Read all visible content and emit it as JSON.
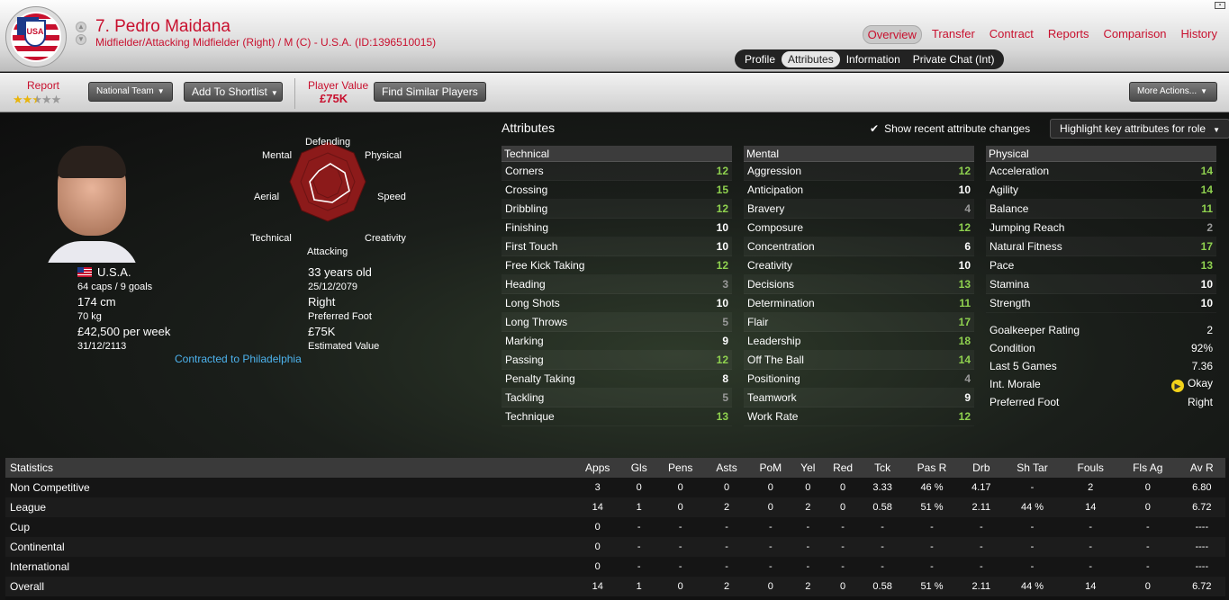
{
  "header": {
    "player_name": "7. Pedro Maidana",
    "subtitle": "Midfielder/Attacking Midfielder (Right) / M (C) - U.S.A. (ID:1396510015)",
    "crest_text": "USA",
    "nav": [
      "Overview",
      "Transfer",
      "Contract",
      "Reports",
      "Comparison",
      "History"
    ],
    "nav_active": "Overview",
    "subtabs": [
      "Profile",
      "Attributes",
      "Information",
      "Private Chat (Int)"
    ],
    "subtab_active": "Attributes"
  },
  "toolbar": {
    "report_label": "Report",
    "report_stars": 2.5,
    "national_team": "National Team",
    "add_shortlist": "Add To Shortlist",
    "player_value_label": "Player Value",
    "player_value": "£75K",
    "find_similar": "Find Similar Players",
    "more_actions": "More Actions..."
  },
  "profile": {
    "radar_labels": {
      "defending": "Defending",
      "physical": "Physical",
      "speed": "Speed",
      "creativity": "Creativity",
      "attacking": "Attacking",
      "technical": "Technical",
      "aerial": "Aerial",
      "mental": "Mental"
    },
    "nationality": "U.S.A.",
    "caps_goals": "64 caps / 9 goals",
    "height": "174 cm",
    "weight": "70 kg",
    "wage": "£42,500 per week",
    "contract_end": "31/12/2113",
    "age": "33 years old",
    "dob": "25/12/2079",
    "preferred_foot": "Right",
    "preferred_foot_label": "Preferred Foot",
    "estimated_value": "£75K",
    "estimated_value_label": "Estimated Value",
    "contracted_to": "Contracted to Philadelphia"
  },
  "attributes": {
    "title": "Attributes",
    "show_changes_label": "Show recent attribute changes",
    "show_changes_checked": true,
    "highlight_button": "Highlight key attributes for role",
    "technical": {
      "heading": "Technical",
      "items": [
        {
          "name": "Corners",
          "value": "12"
        },
        {
          "name": "Crossing",
          "value": "15"
        },
        {
          "name": "Dribbling",
          "value": "12"
        },
        {
          "name": "Finishing",
          "value": "10"
        },
        {
          "name": "First Touch",
          "value": "10"
        },
        {
          "name": "Free Kick Taking",
          "value": "12"
        },
        {
          "name": "Heading",
          "value": "3"
        },
        {
          "name": "Long Shots",
          "value": "10"
        },
        {
          "name": "Long Throws",
          "value": "5"
        },
        {
          "name": "Marking",
          "value": "9"
        },
        {
          "name": "Passing",
          "value": "12"
        },
        {
          "name": "Penalty Taking",
          "value": "8"
        },
        {
          "name": "Tackling",
          "value": "5"
        },
        {
          "name": "Technique",
          "value": "13"
        }
      ]
    },
    "mental": {
      "heading": "Mental",
      "items": [
        {
          "name": "Aggression",
          "value": "12"
        },
        {
          "name": "Anticipation",
          "value": "10"
        },
        {
          "name": "Bravery",
          "value": "4"
        },
        {
          "name": "Composure",
          "value": "12"
        },
        {
          "name": "Concentration",
          "value": "6"
        },
        {
          "name": "Creativity",
          "value": "10"
        },
        {
          "name": "Decisions",
          "value": "13"
        },
        {
          "name": "Determination",
          "value": "11"
        },
        {
          "name": "Flair",
          "value": "17"
        },
        {
          "name": "Leadership",
          "value": "18"
        },
        {
          "name": "Off The Ball",
          "value": "14"
        },
        {
          "name": "Positioning",
          "value": "4"
        },
        {
          "name": "Teamwork",
          "value": "9"
        },
        {
          "name": "Work Rate",
          "value": "12"
        }
      ]
    },
    "physical": {
      "heading": "Physical",
      "items": [
        {
          "name": "Acceleration",
          "value": "14"
        },
        {
          "name": "Agility",
          "value": "14"
        },
        {
          "name": "Balance",
          "value": "11"
        },
        {
          "name": "Jumping Reach",
          "value": "2"
        },
        {
          "name": "Natural Fitness",
          "value": "17"
        },
        {
          "name": "Pace",
          "value": "13"
        },
        {
          "name": "Stamina",
          "value": "10"
        },
        {
          "name": "Strength",
          "value": "10"
        }
      ]
    },
    "extra": [
      {
        "name": "Goalkeeper Rating",
        "value": "2"
      },
      {
        "name": "Condition",
        "value": "92%"
      },
      {
        "name": "Last 5 Games",
        "value": "7.36"
      },
      {
        "name": "Int. Morale",
        "value": "Okay"
      },
      {
        "name": "Preferred Foot",
        "value": "Right"
      }
    ]
  },
  "statistics": {
    "headers": [
      "Statistics",
      "Apps",
      "Gls",
      "Pens",
      "Asts",
      "PoM",
      "Yel",
      "Red",
      "Tck",
      "Pas R",
      "Drb",
      "Sh Tar",
      "Fouls",
      "Fls Ag",
      "Av R"
    ],
    "rows": [
      [
        "Non Competitive",
        "3",
        "0",
        "0",
        "0",
        "0",
        "0",
        "0",
        "3.33",
        "46 %",
        "4.17",
        "-",
        "2",
        "0",
        "6.80"
      ],
      [
        "League",
        "14",
        "1",
        "0",
        "2",
        "0",
        "2",
        "0",
        "0.58",
        "51 %",
        "2.11",
        "44 %",
        "14",
        "0",
        "6.72"
      ],
      [
        "Cup",
        "0",
        "-",
        "-",
        "-",
        "-",
        "-",
        "-",
        "-",
        "-",
        "-",
        "-",
        "-",
        "-",
        "----"
      ],
      [
        "Continental",
        "0",
        "-",
        "-",
        "-",
        "-",
        "-",
        "-",
        "-",
        "-",
        "-",
        "-",
        "-",
        "-",
        "----"
      ],
      [
        "International",
        "0",
        "-",
        "-",
        "-",
        "-",
        "-",
        "-",
        "-",
        "-",
        "-",
        "-",
        "-",
        "-",
        "----"
      ],
      [
        "Overall",
        "14",
        "1",
        "0",
        "2",
        "0",
        "2",
        "0",
        "0.58",
        "51 %",
        "2.11",
        "44 %",
        "14",
        "0",
        "6.72"
      ]
    ]
  },
  "colors": {
    "accent_red": "#c8102e",
    "attr_high": "#8fd14f",
    "attr_low": "#999999",
    "link_blue": "#4db3ee"
  }
}
